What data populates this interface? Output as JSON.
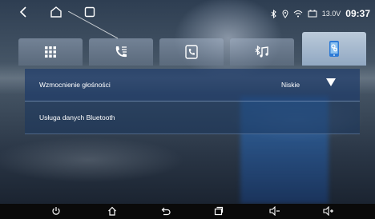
{
  "statusbar": {
    "voltage": "13.0V",
    "time": "09:37"
  },
  "tabs": [
    {
      "icon": "apps-grid-icon",
      "active": false
    },
    {
      "icon": "phone-contacts-icon",
      "active": false
    },
    {
      "icon": "call-log-icon",
      "active": false
    },
    {
      "icon": "bluetooth-music-icon",
      "active": false
    },
    {
      "icon": "phone-settings-icon",
      "active": true
    }
  ],
  "settings": {
    "rows": [
      {
        "label": "Wzmocnienie głośności",
        "value": "Niskie"
      },
      {
        "label": "Usługa danych Bluetooth",
        "value": ""
      }
    ]
  },
  "bottombar": {
    "icons": [
      "power-icon",
      "home-icon",
      "back-icon",
      "recent-apps-icon",
      "volume-down-icon",
      "volume-up-icon"
    ]
  },
  "colors": {
    "active_tab": "#cfe0f2",
    "row_bg": "#1e3c69",
    "bottom_bar": "#0a0a0a"
  }
}
